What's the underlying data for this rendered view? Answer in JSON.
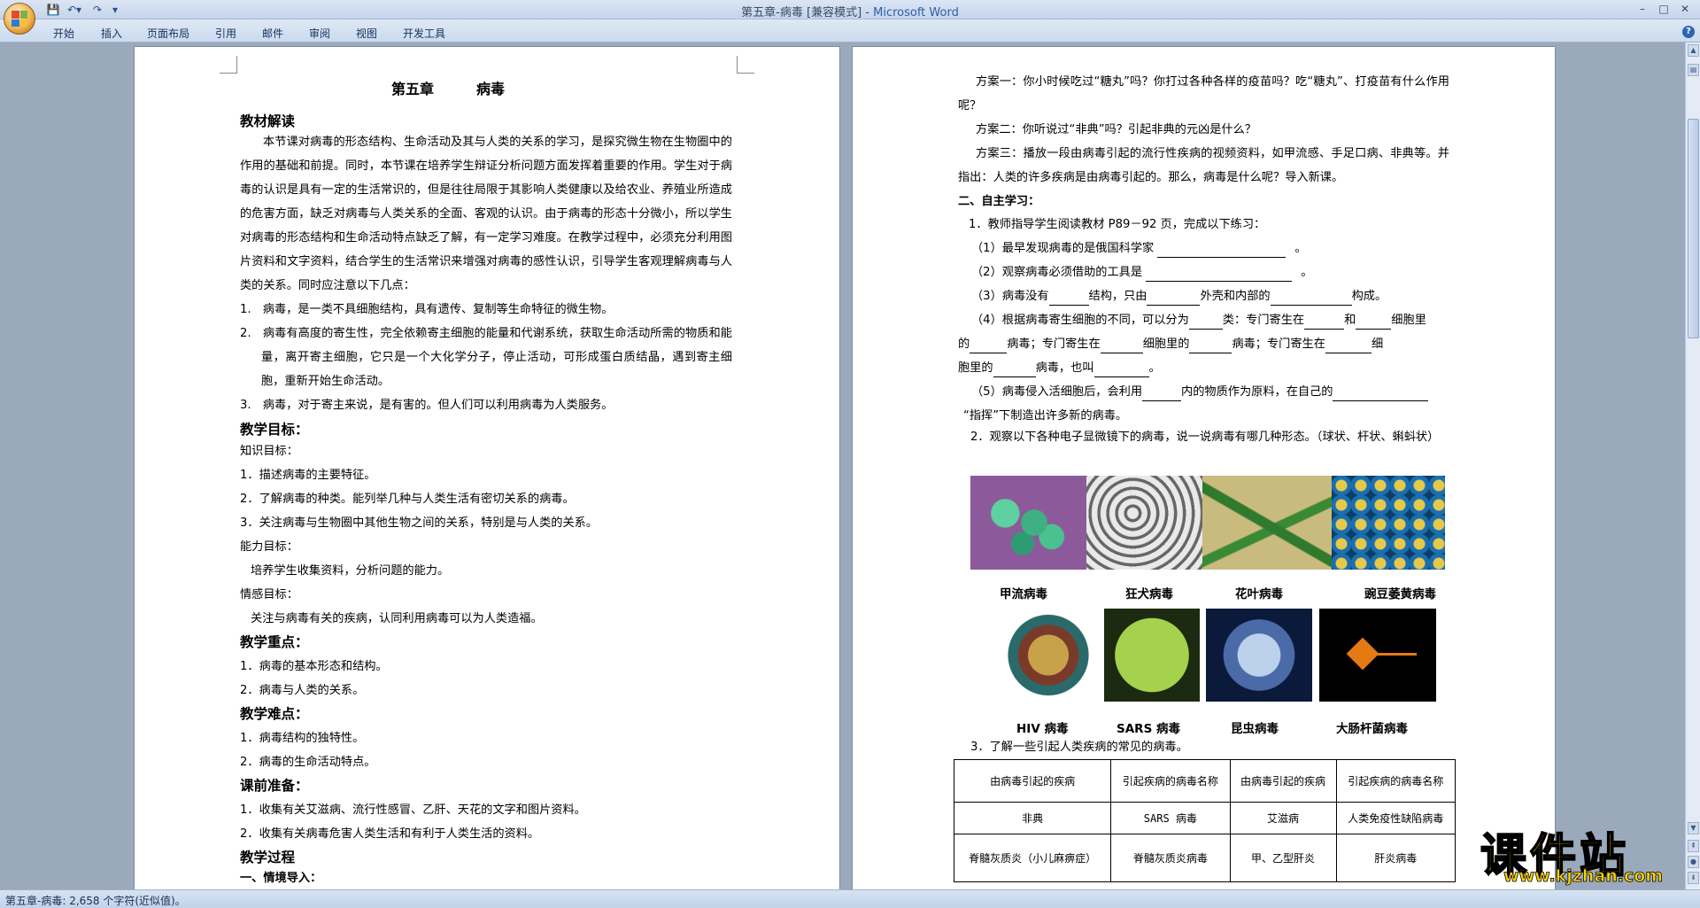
{
  "window": {
    "title_doc": "第五章-病毒 [兼容模式] - ",
    "title_app": "Microsoft Word",
    "min": "–",
    "max": "□",
    "close": "✕"
  },
  "ribbon": {
    "tabs": [
      "开始",
      "插入",
      "页面布局",
      "引用",
      "邮件",
      "审阅",
      "视图",
      "开发工具"
    ],
    "help": "?"
  },
  "status": {
    "text": "第五章-病毒: 2,658 个字符(近似值)。"
  },
  "left_page": {
    "chapter_title": "第五章　　　病毒",
    "h1": "教材解读",
    "intro": "本节课对病毒的形态结构、生命活动及其与人类的关系的学习，是探究微生物在生物圈中的作用的基础和前提。同时，本节课在培养学生辩证分析问题方面发挥着重要的作用。学生对于病毒的认识是具有一定的生活常识的，但是往往局限于其影响人类健康以及给农业、养殖业所造成的危害方面，缺乏对病毒与人类关系的全面、客观的认识。由于病毒的形态十分微小，所以学生对病毒的形态结构和生命活动特点缺乏了解，有一定学习难度。在教学过程中，必须充分利用图片资料和文字资料，结合学生的生活常识来增强对病毒的感性认识，引导学生客观理解病毒与人类的关系。同时应注意以下几点：",
    "points": [
      "1.　病毒，是一类不具细胞结构，具有遗传、复制等生命特征的微生物。",
      "2.　病毒有高度的寄生性，完全依赖寄主细胞的能量和代谢系统，获取生命活动所需的物质和能量，离开寄主细胞，它只是一个大化学分子，停止活动，可形成蛋白质结晶，遇到寄主细胞，重新开始生命活动。",
      "3.　病毒，对于寄主来说，是有害的。但人们可以利用病毒为人类服务。"
    ],
    "goals_h": "教学目标：",
    "knowledge_h": "知识目标：",
    "knowledge": [
      "1．描述病毒的主要特征。",
      "2．了解病毒的种类。能列举几种与人类生活有密切关系的病毒。",
      "3．关注病毒与生物圈中其他生物之间的关系，特别是与人类的关系。"
    ],
    "ability_h": "能力目标：",
    "ability": "培养学生收集资料，分析问题的能力。",
    "emotion_h": "情感目标：",
    "emotion": "关注与病毒有关的疾病，认同利用病毒可以为人类造福。",
    "key_h": "教学重点：",
    "key": [
      "1．病毒的基本形态和结构。",
      "2．病毒与人类的关系。"
    ],
    "diff_h": "教学难点：",
    "diff": [
      "1．病毒结构的独特性。",
      "2．病毒的生命活动特点。"
    ],
    "prep_h": "课前准备：",
    "prep": [
      "1．收集有关艾滋病、流行性感冒、乙肝、天花的文字和图片资料。",
      "2．收集有关病毒危害人类生活和有利于人类生活的资料。"
    ],
    "process_h": "教学过程",
    "intro_h": "一、情境导入："
  },
  "right_page": {
    "plan1": "方案一：你小时候吃过“糖丸”吗？你打过各种各样的疫苗吗？吃“糖丸”、打疫苗有什么作用呢？",
    "plan2": "方案二：你听说过“非典”吗？引起非典的元凶是什么？",
    "plan3": "方案三：播放一段由病毒引起的流行性疾病的视频资料，如甲流感、手足口病、非典等。并指出：人类的许多疾病是由病毒引起的。那么，病毒是什么呢？导入新课。",
    "self_h": "二、自主学习：",
    "q1": "1．教师指导学生阅读教材 P89－92 页，完成以下练习：",
    "f1": "（1）最早发现病毒的是俄国科学家 ",
    "f1_end": "。",
    "f2": "（2）观察病毒必须借助的工具是 ",
    "f2_end": "。",
    "f3": [
      "（3）病毒没有",
      "结构，只由",
      "外壳和内部的",
      "构成。"
    ],
    "f4a": [
      "（4）根据病毒寄生细胞的不同，可以分为",
      "类：专门寄生在",
      "和",
      "细胞里"
    ],
    "f4b": [
      "的",
      "病毒；专门寄生在",
      "细胞里的",
      "病毒；专门寄生在",
      "细"
    ],
    "f4c": [
      "胞里的",
      "病毒，也叫",
      "。"
    ],
    "f5a": [
      "（5）病毒侵入活细胞后，会利用",
      "内的物质作为原料，在自己的"
    ],
    "f5b": "“指挥”下制造出许多新的病毒。",
    "q2": "2．观察以下各种电子显微镜下的病毒，说一说病毒有哪几种形态。（球状、杆状、蝌蚪状）",
    "viruses_row1": [
      "甲流病毒",
      "狂犬病毒",
      "花叶病毒",
      "豌豆萎黄病毒"
    ],
    "viruses_row2": [
      "HIV 病毒",
      "SARS 病毒",
      "昆虫病毒",
      "大肠杆菌病毒"
    ],
    "q3": "3．了解一些引起人类疾病的常见的病毒。",
    "table": [
      [
        "由病毒引起的疾病",
        "引起疾病的病毒名称",
        "由病毒引起的疾病",
        "引起疾病的病毒名称"
      ],
      [
        "非典",
        "SARS 病毒",
        "艾滋病",
        "人类免疫性缺陷病毒"
      ],
      [
        "脊髓灰质炎（小儿麻痹症）",
        "脊髓灰质炎病毒",
        "甲、乙型肝炎",
        "肝炎病毒"
      ]
    ]
  },
  "watermark": {
    "cn": "课件站",
    "url": "www.kjzhan.com"
  },
  "colors": {
    "accent": "#2b5fa8",
    "watermark": "#ffd400",
    "page_bg": "#9ba9bc"
  }
}
